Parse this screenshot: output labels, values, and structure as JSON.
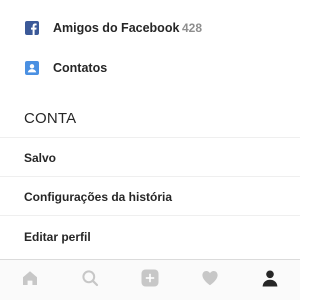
{
  "menu": {
    "facebook_friends": {
      "label": "Amigos do Facebook",
      "count": "428",
      "icon": "facebook-icon"
    },
    "contacts": {
      "label": "Contatos",
      "icon": "contacts-icon"
    }
  },
  "account": {
    "header": "CONTA",
    "items": [
      {
        "label": "Salvo"
      },
      {
        "label": "Configurações da história"
      },
      {
        "label": "Editar perfil"
      }
    ]
  },
  "bottom_nav": {
    "items": [
      {
        "icon": "home-icon"
      },
      {
        "icon": "search-icon"
      },
      {
        "icon": "add-post-icon"
      },
      {
        "icon": "heart-icon"
      },
      {
        "icon": "profile-icon"
      }
    ]
  },
  "colors": {
    "facebook_blue": "#3b5998",
    "contacts_blue": "#4a90e2",
    "text_primary": "#262626",
    "text_secondary": "#8e8e8e",
    "nav_inactive": "#c7c7c7",
    "nav_active": "#262626"
  }
}
